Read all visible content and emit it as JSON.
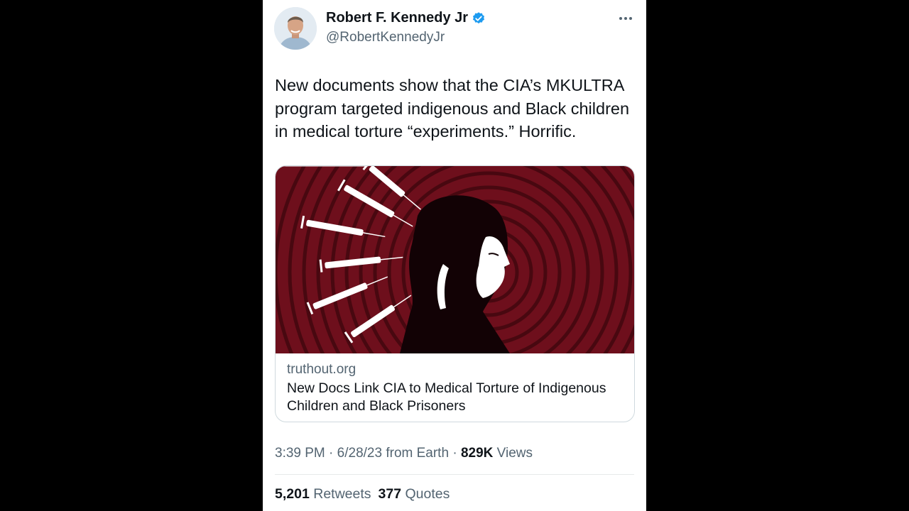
{
  "author": {
    "name": "Robert F. Kennedy Jr",
    "handle": "@RobertKennedyJr",
    "verified": true
  },
  "tweet": {
    "text": "New documents show that the CIA’s MKULTRA program targeted indigenous and Black children in medical torture “experiments.” Horrific."
  },
  "link_card": {
    "domain": "truthout.org",
    "title": "New Docs Link CIA to Medical Torture of Indigenous Children and Black Prisoners",
    "image_subject": "silhouette of child's profile with syringes radiating from head on dark red background"
  },
  "meta": {
    "time": "3:39 PM",
    "separator": " · ",
    "date": "6/28/23",
    "source": " from Earth",
    "views_count": "829K",
    "views_label": " Views"
  },
  "stats": {
    "retweets_count": "5,201",
    "retweets_label": "Retweets",
    "quotes_count": "377",
    "quotes_label": "Quotes"
  },
  "colors": {
    "verified_badge": "#1d9bf0",
    "card_background": "#6e0f1c",
    "secondary_text": "#536471",
    "primary_text": "#0f1419"
  }
}
